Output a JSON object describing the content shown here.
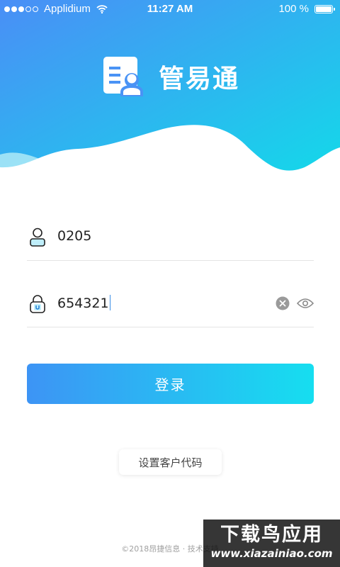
{
  "status_bar": {
    "carrier": "Applidium",
    "time": "11:27 AM",
    "battery": "100 %"
  },
  "app": {
    "name": "管易通"
  },
  "form": {
    "username_value": "0205",
    "password_value": "654321",
    "login_label": "登录"
  },
  "customer_code_label": "设置客户代码",
  "footer": {
    "copyright": "©2018昂捷信息 · 技术支持"
  },
  "watermark": {
    "title": "下载鸟应用",
    "url": "www.xiazainiao.com"
  },
  "icons": {
    "status": [
      "signal-dots-icon",
      "wifi-icon",
      "battery-icon"
    ],
    "logo": "contact-card-icon",
    "username": "user-icon",
    "password": "lock-icon",
    "clear": "clear-icon",
    "visibility": "eye-icon"
  },
  "colors": {
    "gradient_start": "#3d94f5",
    "gradient_end": "#16def0",
    "text": "#222222",
    "divider": "#e4e4e4",
    "caret": "#3a8ee6"
  }
}
